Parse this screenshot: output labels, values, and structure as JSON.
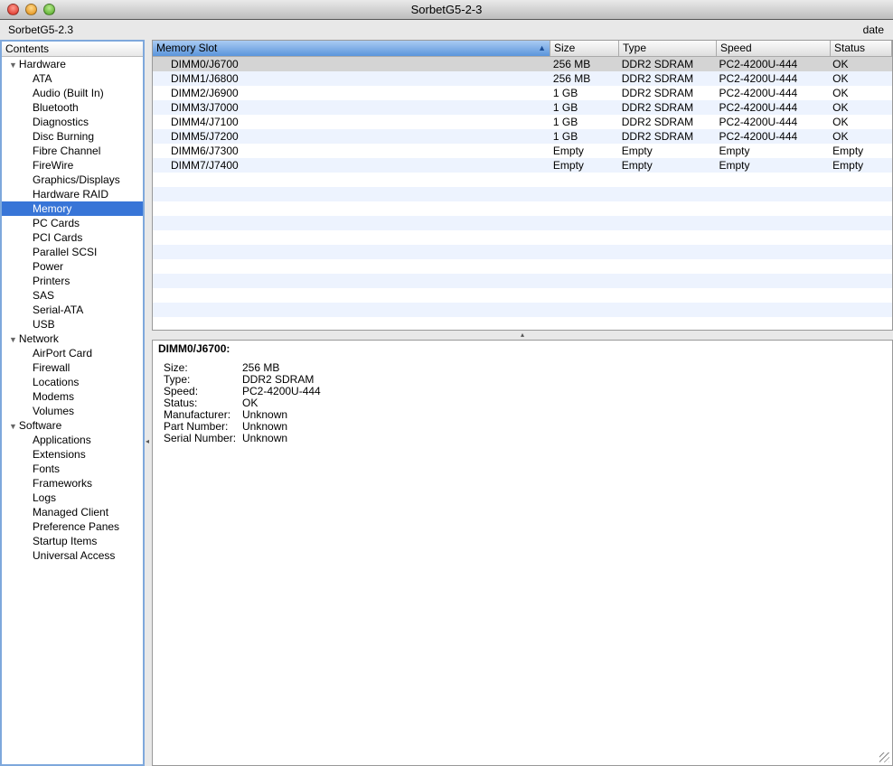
{
  "window": {
    "title": "SorbetG5-2-3",
    "computer_name": "SorbetG5-2.3",
    "date_label": "date"
  },
  "sidebar": {
    "header": "Contents",
    "groups": [
      {
        "label": "Hardware",
        "items": [
          "ATA",
          "Audio (Built In)",
          "Bluetooth",
          "Diagnostics",
          "Disc Burning",
          "Fibre Channel",
          "FireWire",
          "Graphics/Displays",
          "Hardware RAID",
          "Memory",
          "PC Cards",
          "PCI Cards",
          "Parallel SCSI",
          "Power",
          "Printers",
          "SAS",
          "Serial-ATA",
          "USB"
        ]
      },
      {
        "label": "Network",
        "items": [
          "AirPort Card",
          "Firewall",
          "Locations",
          "Modems",
          "Volumes"
        ]
      },
      {
        "label": "Software",
        "items": [
          "Applications",
          "Extensions",
          "Fonts",
          "Frameworks",
          "Logs",
          "Managed Client",
          "Preference Panes",
          "Startup Items",
          "Universal Access"
        ]
      }
    ],
    "selected": "Memory"
  },
  "table": {
    "columns": [
      "Memory Slot",
      "Size",
      "Type",
      "Speed",
      "Status"
    ],
    "rows": [
      [
        "DIMM0/J6700",
        "256 MB",
        "DDR2 SDRAM",
        "PC2-4200U-444",
        "OK"
      ],
      [
        "DIMM1/J6800",
        "256 MB",
        "DDR2 SDRAM",
        "PC2-4200U-444",
        "OK"
      ],
      [
        "DIMM2/J6900",
        "1 GB",
        "DDR2 SDRAM",
        "PC2-4200U-444",
        "OK"
      ],
      [
        "DIMM3/J7000",
        "1 GB",
        "DDR2 SDRAM",
        "PC2-4200U-444",
        "OK"
      ],
      [
        "DIMM4/J7100",
        "1 GB",
        "DDR2 SDRAM",
        "PC2-4200U-444",
        "OK"
      ],
      [
        "DIMM5/J7200",
        "1 GB",
        "DDR2 SDRAM",
        "PC2-4200U-444",
        "OK"
      ],
      [
        "DIMM6/J7300",
        "Empty",
        "Empty",
        "Empty",
        "Empty"
      ],
      [
        "DIMM7/J7400",
        "Empty",
        "Empty",
        "Empty",
        "Empty"
      ]
    ]
  },
  "detail": {
    "title": "DIMM0/J6700:",
    "fields": [
      [
        "Size:",
        "256 MB"
      ],
      [
        "Type:",
        "DDR2 SDRAM"
      ],
      [
        "Speed:",
        "PC2-4200U-444"
      ],
      [
        "Status:",
        "OK"
      ],
      [
        "Manufacturer:",
        "Unknown"
      ],
      [
        "Part Number:",
        "Unknown"
      ],
      [
        "Serial Number:",
        "Unknown"
      ]
    ]
  }
}
